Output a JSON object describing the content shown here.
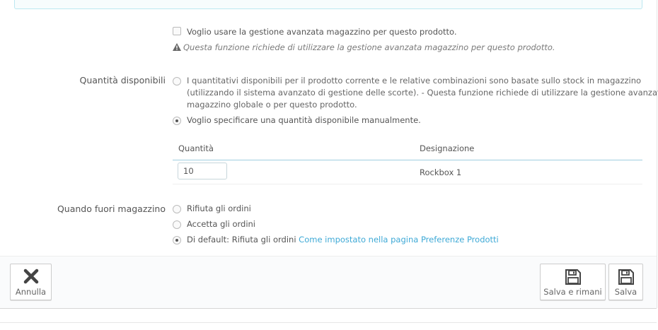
{
  "advanced_stock": {
    "checkbox_label": "Voglio usare la gestione avanzata magazzino per questo prodotto.",
    "warning_text": "Questa funzione richiede di utilizzare la gestione avanzata magazzino per questo prodotto."
  },
  "quantity_section": {
    "label": "Quantità disponibili",
    "option_stock_line1": "I quantitativi disponibili per il prodotto corrente e le relative combinazioni sono basate sullo stock in magazzino",
    "option_stock_line2": "(utilizzando il sistema avanzato di gestione delle scorte).  - Questa funzione richiede di utilizzare la gestione avanzata",
    "option_stock_line3": "magazzino globale o per questo prodotto.",
    "option_manual": "Voglio specificare una quantità disponibile manualmente."
  },
  "table": {
    "col_quantity": "Quantità",
    "col_designation": "Designazione",
    "rows": [
      {
        "quantity": "10",
        "designation": "Rockbox 1"
      }
    ]
  },
  "out_of_stock": {
    "label": "Quando fuori magazzino",
    "option_deny": "Rifiuta gli ordini",
    "option_accept": "Accetta gli ordini",
    "option_default_prefix": "Di default: Rifiuta gli ordini",
    "option_default_link": "Come impostato nella pagina Preferenze Prodotti"
  },
  "footer": {
    "cancel_label": "Annulla",
    "save_stay_label": "Salva e rimani",
    "save_label": "Salva"
  },
  "icons": {
    "warning": "warning-icon",
    "cancel": "close-icon",
    "save": "floppy-disk-icon"
  },
  "colors": {
    "link": "#3ea9d6",
    "info_border": "#bce8f1",
    "table_header_border": "#9fcfe0"
  }
}
